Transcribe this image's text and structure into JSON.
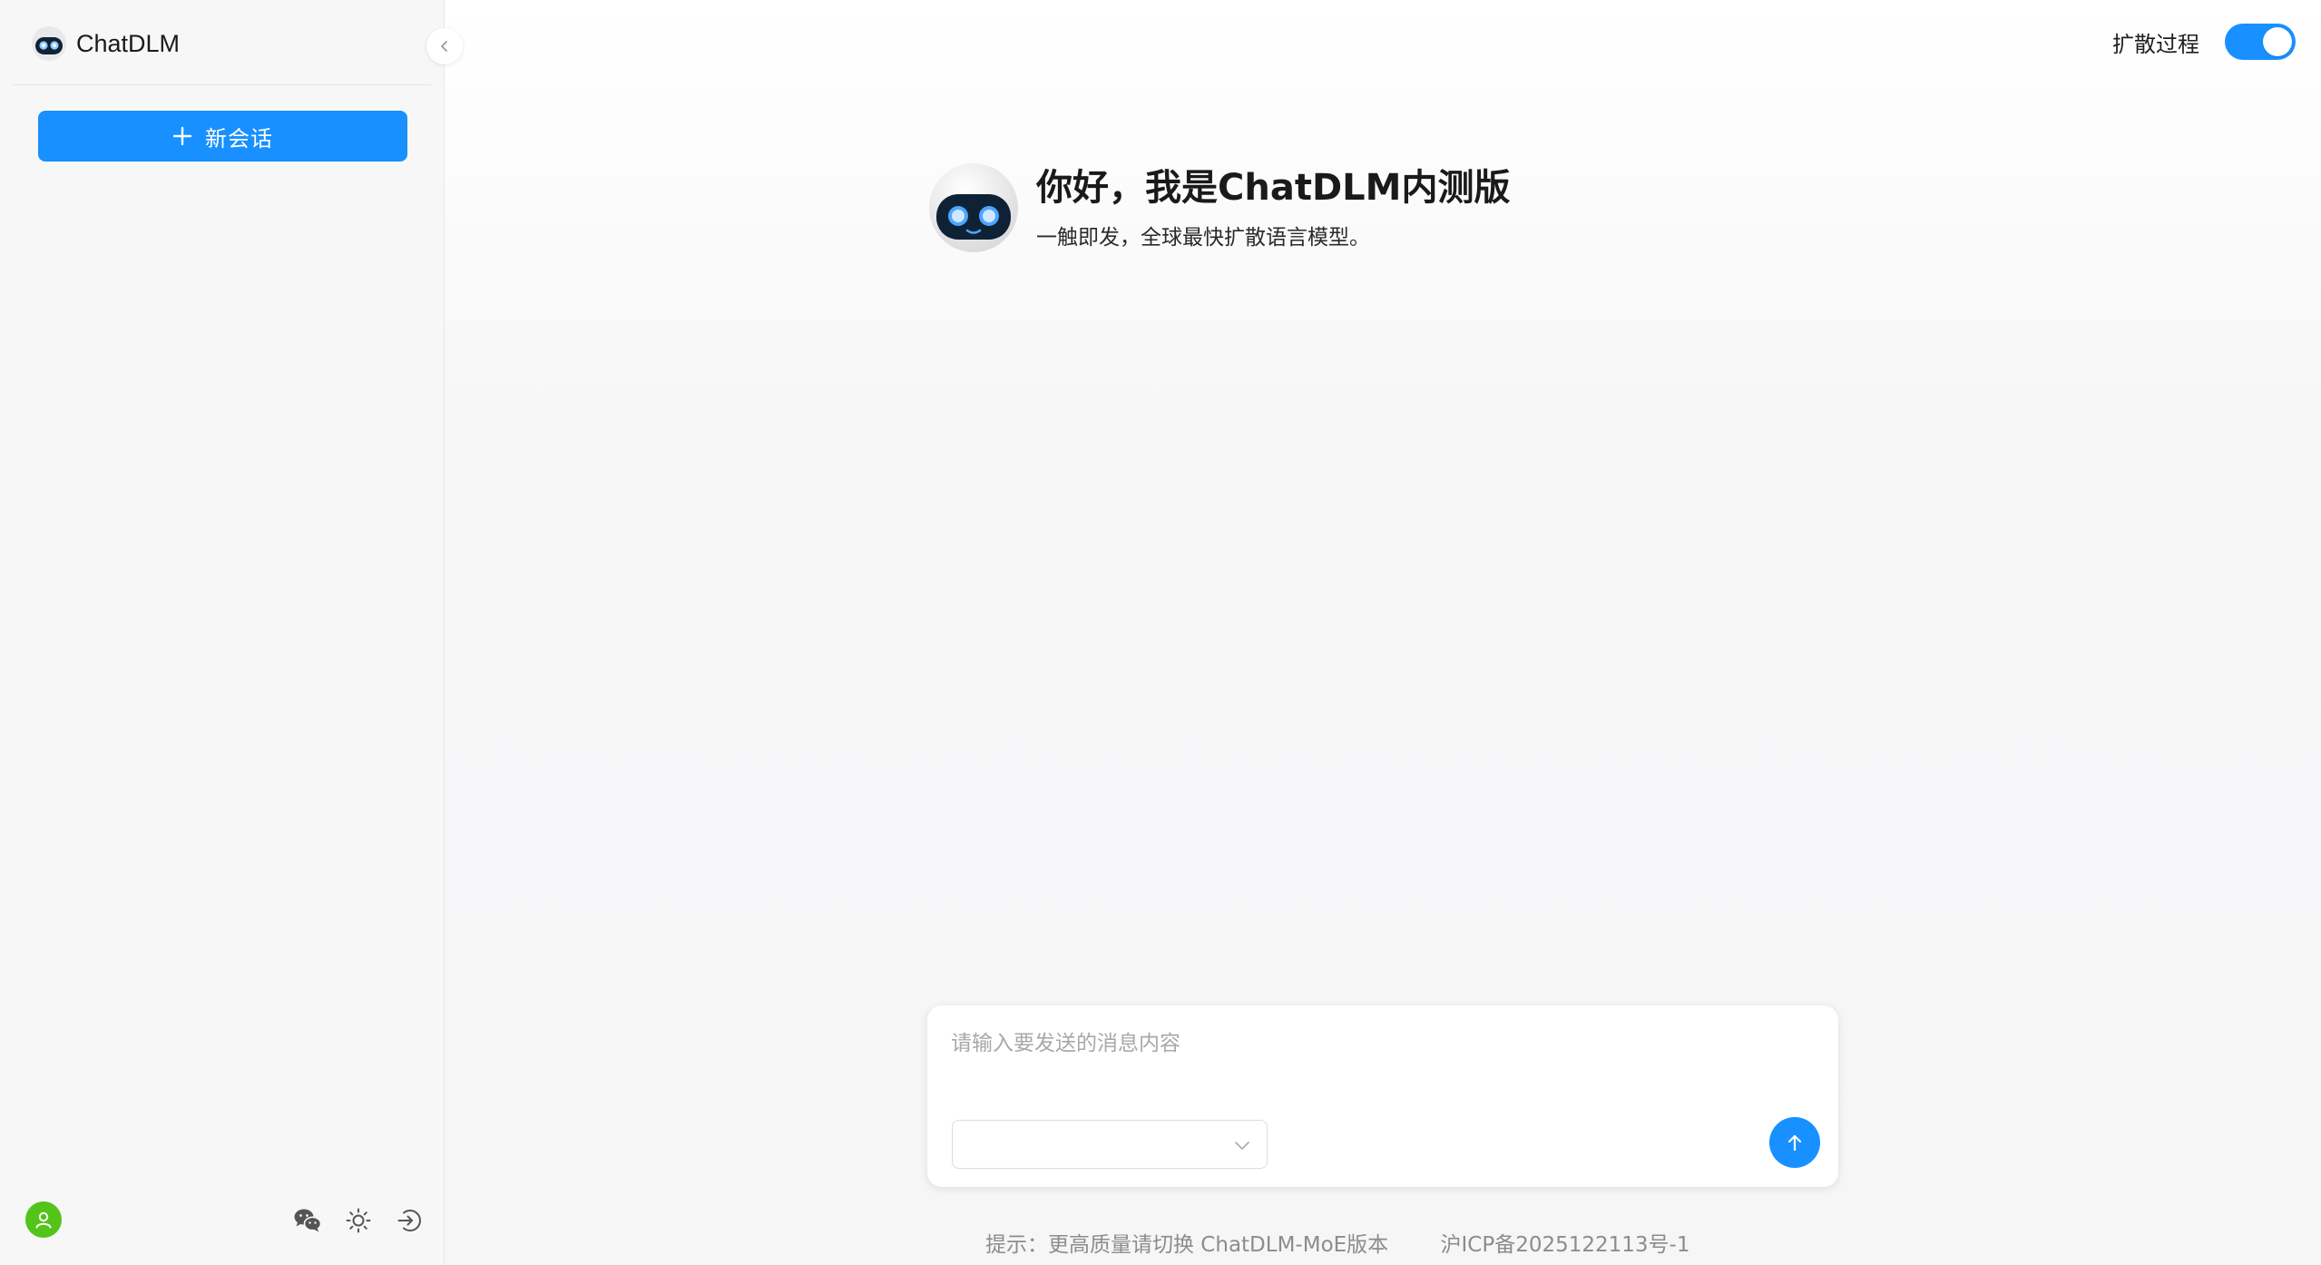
{
  "app": {
    "brand_name": "ChatDLM"
  },
  "sidebar": {
    "new_chat_label": "新会话"
  },
  "header": {
    "diffusion_toggle_label": "扩散过程",
    "diffusion_toggle_on": true
  },
  "welcome": {
    "title": "你好，我是ChatDLM内测版",
    "subtitle": "一触即发，全球最快扩散语言模型。"
  },
  "composer": {
    "placeholder": "请输入要发送的消息内容",
    "model_select_value": ""
  },
  "footer": {
    "tip": "提示：更高质量请切换 ChatDLM-MoE版本",
    "icp": "沪ICP备2025122113号-1"
  },
  "colors": {
    "accent": "#1890ff",
    "avatar": "#52c41a",
    "robot_face": "#0f2235",
    "robot_eye": "#8ec7ff"
  },
  "icons": {
    "collapse": "chevron-left-icon",
    "new_chat": "plus-icon",
    "avatar": "user-icon",
    "wechat": "wechat-icon",
    "theme": "sun-icon",
    "logout": "logout-icon",
    "select": "chevron-down-icon",
    "send": "arrow-up-icon"
  }
}
